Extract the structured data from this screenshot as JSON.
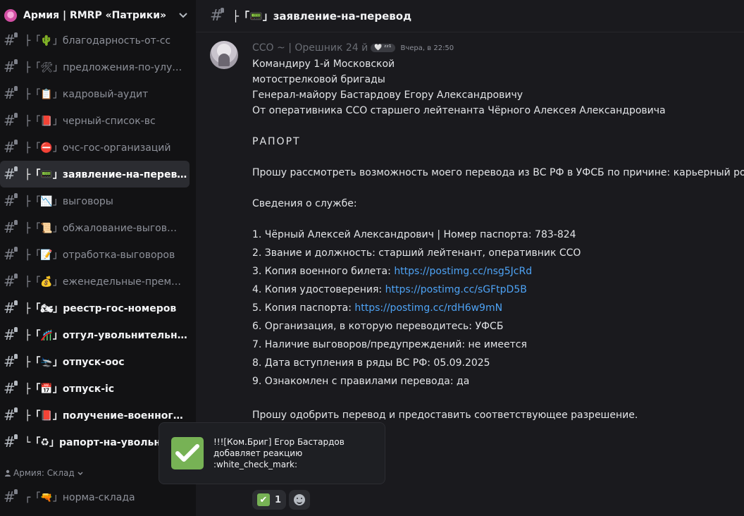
{
  "server": {
    "name": "Армия | RMRP «Патрики»"
  },
  "channels": [
    {
      "name": "├「🌵」благодарность-от-сс",
      "unread": false
    },
    {
      "name": "├「🛠」предложения-по-улу…",
      "unread": false
    },
    {
      "name": "├「📋」кадровый-аудит",
      "unread": false
    },
    {
      "name": "├「📕」черный-список-вс",
      "unread": false
    },
    {
      "name": "├「⛔」очс-гос-организаций",
      "unread": false
    },
    {
      "name": "├「📟」заявление-на-перев…",
      "unread": false,
      "active": true
    },
    {
      "name": "├「📉」выговоры",
      "unread": false
    },
    {
      "name": "├「📜」обжалование-выгов…",
      "unread": false
    },
    {
      "name": "├「📝」отработка-выговоров",
      "unread": false
    },
    {
      "name": "├「💰」еженедельные-прем…",
      "unread": false
    },
    {
      "name": "├「🏍」реестр-гос-номеров",
      "unread": true
    },
    {
      "name": "├「🎢」отгул-увольнительная",
      "unread": true
    },
    {
      "name": "├「🛬」отпуск-оос",
      "unread": true
    },
    {
      "name": "├「📅」отпуск-ic",
      "unread": true
    },
    {
      "name": "├「📕」получение-военного…",
      "unread": true
    },
    {
      "name": "└「♻」рапорт-на-увольне…",
      "unread": true
    }
  ],
  "category": {
    "label": "Армия: Склад",
    "icon": "user-group-icon"
  },
  "last_channel": {
    "name": "┌「🔫」норма-склада"
  },
  "chat": {
    "title": "├「📟」заявление-на-перевод"
  },
  "message": {
    "author": "ССО ~ | Орешник 24 й",
    "badge": "🤍 ᶻᶻ¹",
    "timestamp": "Вчера, в 22:50",
    "lines": {
      "l1": "Командиру 1-й Московской",
      "l2": "мотострелковой бригады",
      "l3": "Генерал-майору Бастардову Егору Александровичу",
      "l4": "От оперативника ССО старшего лейтенанта Чёрного Алексея Александровича",
      "raport": "РАПОРТ",
      "request": "Прошу рассмотреть возможность моего перевода из ВС РФ в УФСБ по причине: карьерный рост.",
      "info_title": "Сведения о службе:",
      "i1": "1. Чёрный Алексей Александрович | Номер паспорта: 783-824",
      "i2": "2. Звание и должность: старший лейтенант, оперативник ССО",
      "i3_label": "3. Копия военного билета: ",
      "i3_link": "https://postimg.cc/nsg5JcRd",
      "i4_label": "4. Копия удостоверения: ",
      "i4_link": "https://postimg.cc/sGFtpD5B",
      "i5_label": "5. Копия паспорта: ",
      "i5_link": "https://postimg.cc/rdH6w9mN",
      "i6": "6. Организация, в которую переводитесь: УФСБ",
      "i7": "7. Наличие выговоров/предупреждений: не имеется",
      "i8": "8. Дата вступления в ряды ВС РФ: 05.09.2025",
      "i9": "9. Ознакомлен с правилами перевода: да",
      "closing": "Прошу одобрить перевод и предоставить соответствующее разрешение."
    }
  },
  "reaction": {
    "emoji": "✔",
    "count": "1"
  },
  "toast": {
    "line1": "!!![Ком.Бриг] Егор Бастардов",
    "line2": "добавляет реакцию",
    "line3": ":white_check_mark:"
  },
  "colors": {
    "link": "#4ea3f5",
    "check_green": "#77b255",
    "sidebar_bg": "#121214",
    "chat_bg": "#1a1a1e"
  }
}
